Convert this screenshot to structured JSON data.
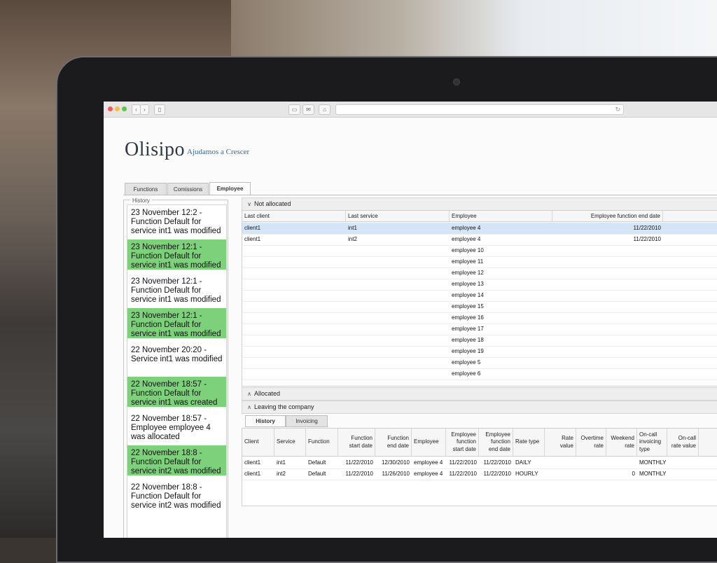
{
  "brand": {
    "name": "Olisipo",
    "tagline": "Ajudamos a Crescer",
    "tagline_color": "#1f6fb5"
  },
  "browser": {
    "buttons": [
      "print",
      "mail",
      "home"
    ]
  },
  "tabs": [
    {
      "label": "Functions",
      "active": false
    },
    {
      "label": "Comissions",
      "active": false
    },
    {
      "label": "Employee",
      "active": true
    }
  ],
  "history": {
    "legend": "History",
    "items": [
      {
        "text": "23 November 12:2 - Function Default for service int1 was modified",
        "green": false
      },
      {
        "text": "23 November 12:1 - Function Default for service int1 was modified",
        "green": true
      },
      {
        "text": "23 November 12:1 - Function Default for service int1 was modified",
        "green": false
      },
      {
        "text": "23 November 12:1 - Function Default for service int1 was modified",
        "green": true
      },
      {
        "text": "22 November 20:20 - Service int1 was modified",
        "green": false
      },
      {
        "text": "22 November 18:57 - Function Default for service int1 was created",
        "green": true
      },
      {
        "text": "22 November 18:57 - Employee employee 4 was allocated",
        "green": false
      },
      {
        "text": "22 November 18:8 - Function Default for service int2 was modified",
        "green": true
      },
      {
        "text": "22 November 18:8 - Function Default for service int2 was modified",
        "green": false
      }
    ],
    "highlight_color": "#7dd17b"
  },
  "panels": {
    "not_allocated": "Not allocated",
    "allocated": "Allocated",
    "leaving": "Leaving the company"
  },
  "not_allocated_grid": {
    "columns": [
      "Last client",
      "Last service",
      "Employee",
      "Employee function end date"
    ],
    "rows": [
      [
        "client1",
        "int1",
        "employee 4",
        "11/22/2010"
      ],
      [
        "client1",
        "int2",
        "employee 4",
        "11/22/2010"
      ],
      [
        "",
        "",
        "employee 10",
        ""
      ],
      [
        "",
        "",
        "employee 11",
        ""
      ],
      [
        "",
        "",
        "employee 12",
        ""
      ],
      [
        "",
        "",
        "employee 13",
        ""
      ],
      [
        "",
        "",
        "employee 14",
        ""
      ],
      [
        "",
        "",
        "employee 15",
        ""
      ],
      [
        "",
        "",
        "employee 16",
        ""
      ],
      [
        "",
        "",
        "employee 17",
        ""
      ],
      [
        "",
        "",
        "employee 18",
        ""
      ],
      [
        "",
        "",
        "employee 19",
        ""
      ],
      [
        "",
        "",
        "employee 5",
        ""
      ],
      [
        "",
        "",
        "employee 6",
        ""
      ]
    ]
  },
  "subtabs": [
    {
      "label": "History",
      "active": true
    },
    {
      "label": "Invoicing",
      "active": false
    }
  ],
  "leaving_grid": {
    "columns": [
      "Client",
      "Service",
      "Function",
      "Function start date",
      "Function end date",
      "Employee",
      "Employee function start date",
      "Employee function end date",
      "Rate type",
      "Rate value",
      "Overtime rate",
      "Weekend rate",
      "On-call invoicing type",
      "On-call rate value"
    ],
    "rows": [
      [
        "client1",
        "int1",
        "Default",
        "11/22/2010",
        "12/30/2010",
        "employee 4",
        "11/22/2010",
        "11/22/2010",
        "DAILY",
        "",
        "",
        "",
        "MONTHLY",
        ""
      ],
      [
        "client1",
        "int2",
        "Default",
        "11/22/2010",
        "11/26/2010",
        "employee 4",
        "11/22/2010",
        "11/22/2010",
        "HOURLY",
        "",
        "",
        "0",
        "MONTHLY",
        ""
      ]
    ]
  }
}
